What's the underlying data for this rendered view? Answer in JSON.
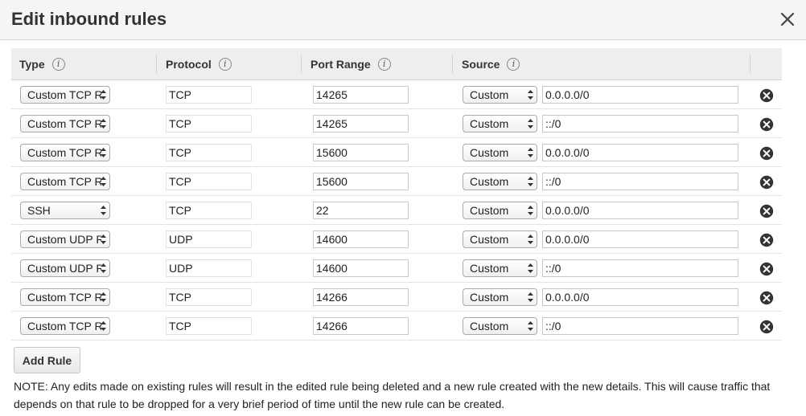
{
  "dialog": {
    "title": "Edit inbound rules",
    "close_icon": "close-icon"
  },
  "table": {
    "headers": {
      "type": "Type",
      "protocol": "Protocol",
      "port_range": "Port Range",
      "source": "Source"
    },
    "info_glyph": "i",
    "rows": [
      {
        "type": "Custom TCP Rule",
        "protocol": "TCP",
        "port": "14265",
        "source_type": "Custom",
        "source": "0.0.0.0/0"
      },
      {
        "type": "Custom TCP Rule",
        "protocol": "TCP",
        "port": "14265",
        "source_type": "Custom",
        "source": "::/0"
      },
      {
        "type": "Custom TCP Rule",
        "protocol": "TCP",
        "port": "15600",
        "source_type": "Custom",
        "source": "0.0.0.0/0"
      },
      {
        "type": "Custom TCP Rule",
        "protocol": "TCP",
        "port": "15600",
        "source_type": "Custom",
        "source": "::/0"
      },
      {
        "type": "SSH",
        "protocol": "TCP",
        "port": "22",
        "source_type": "Custom",
        "source": "0.0.0.0/0"
      },
      {
        "type": "Custom UDP Rule",
        "protocol": "UDP",
        "port": "14600",
        "source_type": "Custom",
        "source": "0.0.0.0/0"
      },
      {
        "type": "Custom UDP Rule",
        "protocol": "UDP",
        "port": "14600",
        "source_type": "Custom",
        "source": "::/0"
      },
      {
        "type": "Custom TCP Rule",
        "protocol": "TCP",
        "port": "14266",
        "source_type": "Custom",
        "source": "0.0.0.0/0"
      },
      {
        "type": "Custom TCP Rule",
        "protocol": "TCP",
        "port": "14266",
        "source_type": "Custom",
        "source": "::/0"
      }
    ]
  },
  "actions": {
    "add_rule": "Add Rule"
  },
  "note": "NOTE: Any edits made on existing rules will result in the edited rule being deleted and a new rule created with the new details. This will cause traffic that depends on that rule to be dropped for a very brief period of time until the new rule can be created."
}
